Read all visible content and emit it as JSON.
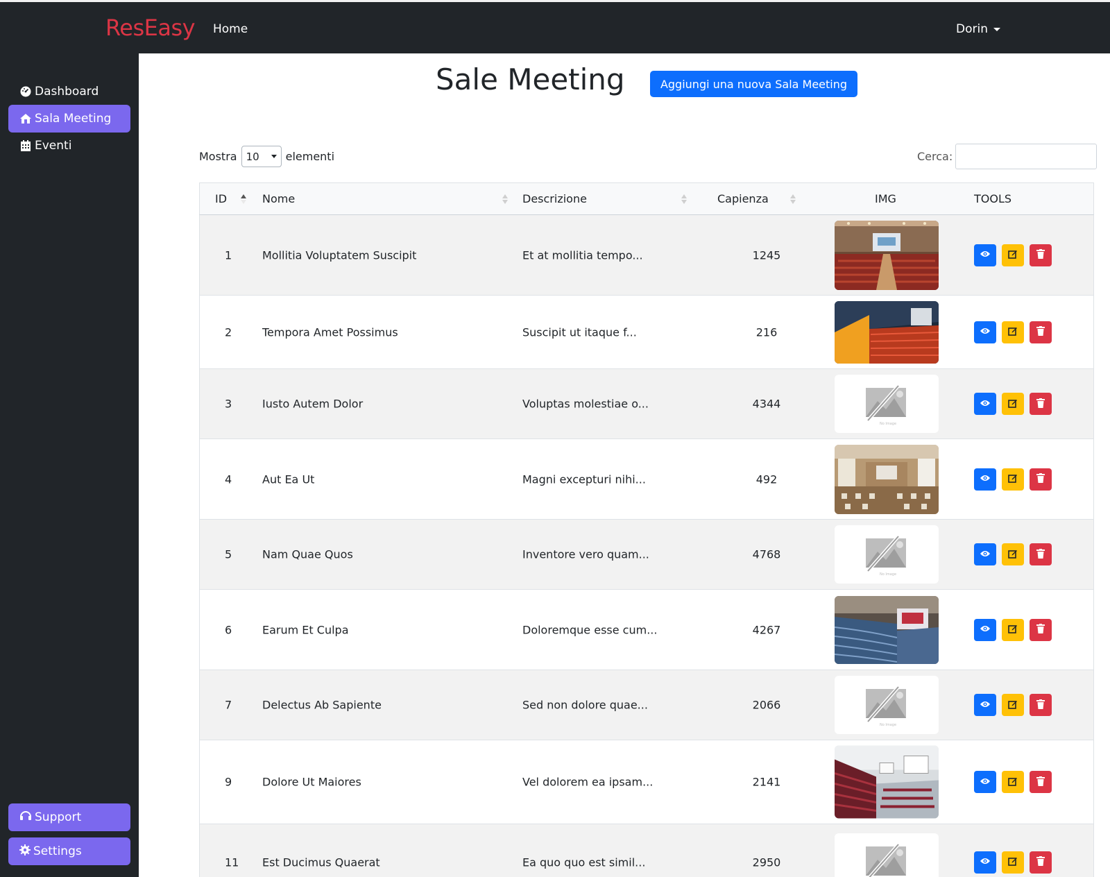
{
  "navbar": {
    "brand": "ResEasy",
    "home_link": "Home",
    "user_name": "Dorin"
  },
  "sidebar": {
    "items": [
      {
        "label": "Dashboard",
        "icon": "dashboard-icon"
      },
      {
        "label": "Sala Meeting",
        "icon": "home-icon",
        "active": true
      },
      {
        "label": "Eventi",
        "icon": "calendar-icon"
      }
    ],
    "support_label": "Support",
    "settings_label": "Settings"
  },
  "page": {
    "title": "Sale Meeting",
    "add_button": "Aggiungi una nuova Sala Meeting"
  },
  "table_controls": {
    "show_prefix": "Mostra",
    "show_value": "10",
    "show_suffix": "elementi",
    "search_label": "Cerca:",
    "search_value": ""
  },
  "table": {
    "columns": [
      "ID",
      "Nome",
      "Descrizione",
      "Capienza",
      "IMG",
      "TOOLS"
    ],
    "sorted_column": "ID",
    "rows": [
      {
        "id": "1",
        "nome": "Mollitia Voluptatem Suscipit",
        "descrizione": "Et at mollitia tempo...",
        "capienza": "1245",
        "img": "conference-hall-photo"
      },
      {
        "id": "2",
        "nome": "Tempora Amet Possimus",
        "descrizione": "Suscipit ut itaque f...",
        "capienza": "216",
        "img": "auditorium-photo"
      },
      {
        "id": "3",
        "nome": "Iusto Autem Dolor",
        "descrizione": "Voluptas molestiae o...",
        "capienza": "4344",
        "img": "no-image"
      },
      {
        "id": "4",
        "nome": "Aut Ea Ut",
        "descrizione": "Magni excepturi nihi...",
        "capienza": "492",
        "img": "meeting-room-photo"
      },
      {
        "id": "5",
        "nome": "Nam Quae Quos",
        "descrizione": "Inventore vero quam...",
        "capienza": "4768",
        "img": "no-image"
      },
      {
        "id": "6",
        "nome": "Earum Et Culpa",
        "descrizione": "Doloremque esse cum...",
        "capienza": "4267",
        "img": "theater-photo"
      },
      {
        "id": "7",
        "nome": "Delectus Ab Sapiente",
        "descrizione": "Sed non dolore quae...",
        "capienza": "2066",
        "img": "no-image"
      },
      {
        "id": "9",
        "nome": "Dolore Ut Maiores",
        "descrizione": "Vel dolorem ea ipsam...",
        "capienza": "2141",
        "img": "lecture-hall-photo"
      },
      {
        "id": "11",
        "nome": "Est Ducimus Quaerat",
        "descrizione": "Ea quo quo est simil...",
        "capienza": "2950",
        "img": "no-image"
      }
    ],
    "no_image_caption": "No Image"
  },
  "colors": {
    "navbar_bg": "#212529",
    "brand": "#dc3545",
    "sidebar_accent": "#7b68ee",
    "primary": "#0d6efd",
    "warning": "#ffc107",
    "danger": "#dc3545"
  }
}
